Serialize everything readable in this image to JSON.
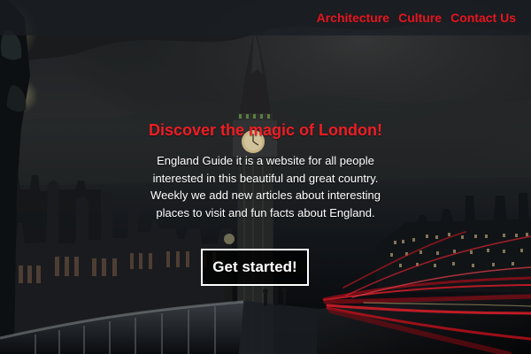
{
  "navigation": {
    "items": [
      {
        "label": "Architecture"
      },
      {
        "label": "Culture"
      },
      {
        "label": "Contact Us"
      }
    ]
  },
  "hero": {
    "headline": "Discover the magic of London!",
    "description_lines": [
      "England Guide it is a website for all people",
      "interested in this beautiful and great country.",
      "Weekly we add new articles about interesting",
      "places to visit and fun facts about England."
    ],
    "cta_label": "Get started!"
  },
  "colors": {
    "accent": "#e7141f",
    "text": "#ffffff",
    "overlay": "#1a1e22"
  }
}
